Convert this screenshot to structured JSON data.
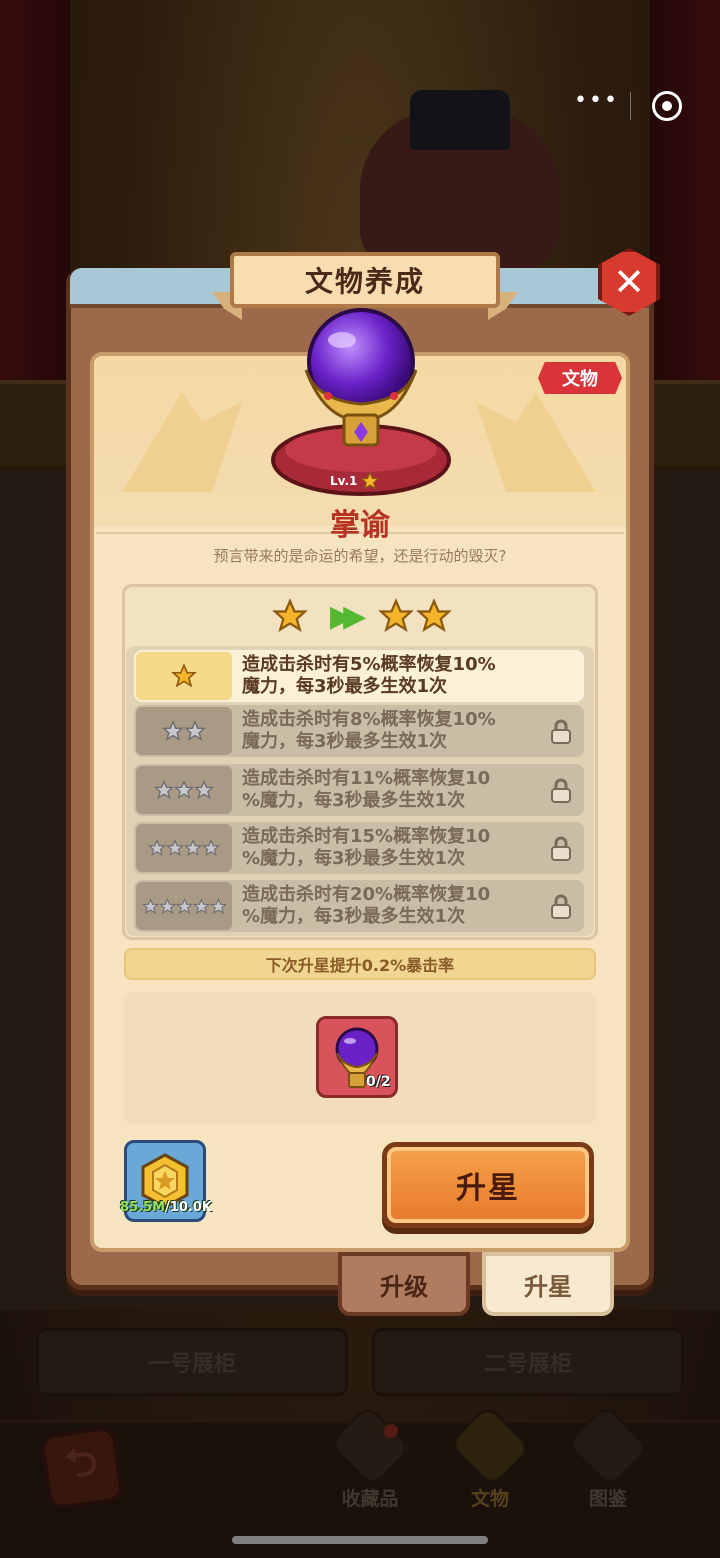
{
  "capsule": {
    "more_icon": "more-dots-icon",
    "close_icon": "target-icon"
  },
  "dialog": {
    "title": "文物养成",
    "tag": "文物",
    "level": "Lv.1",
    "name": "掌谕",
    "description": "预言带来的是命运的希望，还是行动的毁灭?",
    "current_stars": 1,
    "next_stars": 2,
    "star_rows": [
      {
        "stars": 1,
        "line1": "造成击杀时有5%概率恢复10%",
        "line2": "魔力，每3秒最多生效1次",
        "locked": false
      },
      {
        "stars": 2,
        "line1": "造成击杀时有8%概率恢复10%",
        "line2": "魔力，每3秒最多生效1次",
        "locked": true
      },
      {
        "stars": 3,
        "line1": "造成击杀时有11%概率恢复10",
        "line2": "%魔力，每3秒最多生效1次",
        "locked": true
      },
      {
        "stars": 4,
        "line1": "造成击杀时有15%概率恢复10",
        "line2": "%魔力，每3秒最多生效1次",
        "locked": true
      },
      {
        "stars": 5,
        "line1": "造成击杀时有20%概率恢复10",
        "line2": "%魔力，每3秒最多生效1次",
        "locked": true
      }
    ],
    "next_hint": "下次升星提升0.2%暴击率",
    "material_count": "0/2",
    "coin_have": "85.5M",
    "coin_need": "/10.0K",
    "upgrade_star_button": "升星",
    "tabs": {
      "upgrade": "升级",
      "star": "升星"
    }
  },
  "background": {
    "cabinet1": "一号展柜",
    "cabinet2": "二号展柜",
    "nav": {
      "collection": "收藏品",
      "relic": "文物",
      "codex": "图鉴"
    }
  },
  "colors": {
    "accent": "#e87a2a",
    "title_red": "#b83222",
    "star": "#f5b52a",
    "arrow_green": "#54b830"
  }
}
